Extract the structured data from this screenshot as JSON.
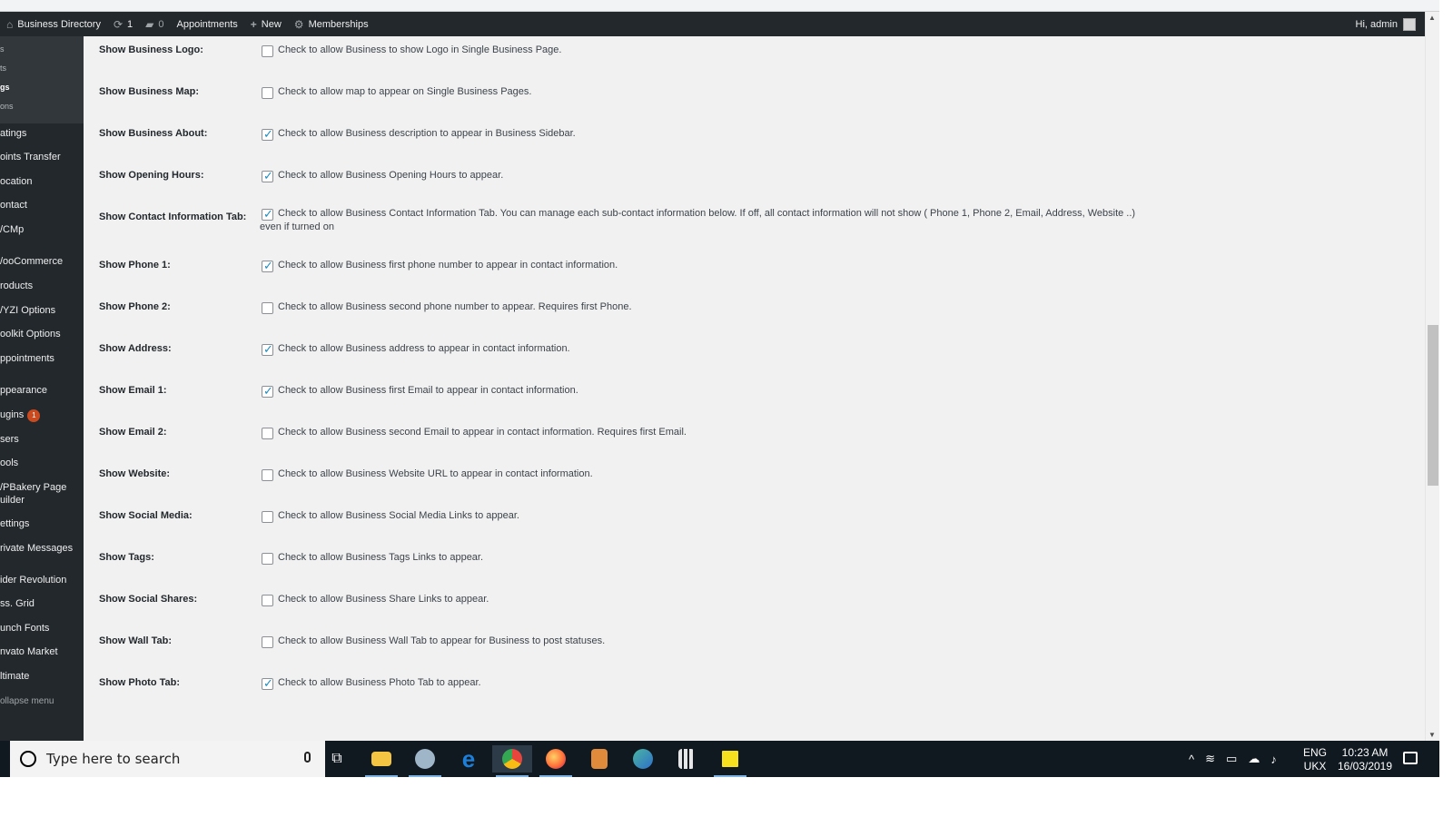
{
  "admin_bar": {
    "site_name": "Business Directory",
    "updates_count": "1",
    "comments_count": "0",
    "appointments": "Appointments",
    "new": "New",
    "memberships": "Memberships",
    "greeting": "Hi, admin"
  },
  "sidebar": {
    "sub_items": [
      {
        "label": "s"
      },
      {
        "label": "ts"
      },
      {
        "label": "gs"
      },
      {
        "label": "ons"
      }
    ],
    "items": [
      {
        "label": "atings",
        "badge": ""
      },
      {
        "label": "oints Transfer",
        "badge": ""
      },
      {
        "label": "ocation",
        "badge": ""
      },
      {
        "label": "ontact",
        "badge": ""
      },
      {
        "label": "/CMp",
        "badge": ""
      },
      {
        "label": "/ooCommerce",
        "badge": ""
      },
      {
        "label": "roducts",
        "badge": ""
      },
      {
        "label": "/YZI Options",
        "badge": ""
      },
      {
        "label": "oolkit Options",
        "badge": ""
      },
      {
        "label": "ppointments",
        "badge": ""
      },
      {
        "label": "ppearance",
        "badge": ""
      },
      {
        "label": "ugins",
        "badge": "1"
      },
      {
        "label": "sers",
        "badge": ""
      },
      {
        "label": "ools",
        "badge": ""
      },
      {
        "label": "/PBakery Page",
        "label2": "uilder",
        "badge": ""
      },
      {
        "label": "ettings",
        "badge": ""
      },
      {
        "label": "rivate Messages",
        "badge": ""
      },
      {
        "label": "ider Revolution",
        "badge": ""
      },
      {
        "label": "ss. Grid",
        "badge": ""
      },
      {
        "label": "unch Fonts",
        "badge": ""
      },
      {
        "label": "nvato Market",
        "badge": ""
      },
      {
        "label": "ltimate",
        "badge": ""
      },
      {
        "label": "ollapse menu",
        "badge": ""
      }
    ]
  },
  "settings": [
    {
      "label": "Show Business Logo:",
      "checked": false,
      "description": "Check to allow Business to show Logo in Single Business Page."
    },
    {
      "label": "Show Business Map:",
      "checked": false,
      "description": "Check to allow map to appear on Single Business Pages."
    },
    {
      "label": "Show Business About:",
      "checked": true,
      "description": "Check to allow Business description to appear in Business Sidebar."
    },
    {
      "label": "Show Opening Hours:",
      "checked": true,
      "description": "Check to allow Business Opening Hours to appear."
    },
    {
      "label": "Show Contact Information Tab:",
      "checked": true,
      "description": "Check to allow Business Contact Information Tab. You can manage each sub-contact information below. If off, all contact information will not show ( Phone 1, Phone 2, Email, Address, Website ..)",
      "description2": "even if turned on"
    },
    {
      "label": "Show Phone 1:",
      "checked": true,
      "description": "Check to allow Business first phone number to appear in contact information."
    },
    {
      "label": "Show Phone 2:",
      "checked": false,
      "description": "Check to allow Business second phone number to appear. Requires first Phone."
    },
    {
      "label": "Show Address:",
      "checked": true,
      "description": "Check to allow Business address to appear in contact information."
    },
    {
      "label": "Show Email 1:",
      "checked": true,
      "description": "Check to allow Business first Email to appear in contact information."
    },
    {
      "label": "Show Email 2:",
      "checked": false,
      "description": "Check to allow Business second Email to appear in contact information. Requires first Email."
    },
    {
      "label": "Show Website:",
      "checked": false,
      "description": "Check to allow Business Website URL to appear in contact information."
    },
    {
      "label": "Show Social Media:",
      "checked": false,
      "description": "Check to allow Business Social Media Links to appear."
    },
    {
      "label": "Show Tags:",
      "checked": false,
      "description": "Check to allow Business Tags Links to appear."
    },
    {
      "label": "Show Social Shares:",
      "checked": false,
      "description": "Check to allow Business Share Links to appear."
    },
    {
      "label": "Show Wall Tab:",
      "checked": false,
      "description": "Check to allow Business Wall Tab to appear for Business to post statuses."
    },
    {
      "label": "Show Photo Tab:",
      "checked": true,
      "description": "Check to allow Business Photo Tab to appear."
    }
  ],
  "taskbar": {
    "search_placeholder": "Type here to search",
    "apps": [
      {
        "icon": "task-view-icon",
        "color": "#ffffff"
      },
      {
        "icon": "file-explorer-icon",
        "color": "#f4c542"
      },
      {
        "icon": "paint-icon",
        "color": "#9fb6c9"
      },
      {
        "icon": "edge-icon",
        "color": "#1e7fd8"
      },
      {
        "icon": "chrome-icon",
        "color": "#e8453c"
      },
      {
        "icon": "firefox-icon",
        "color": "#ff7139"
      },
      {
        "icon": "html-editor-icon",
        "color": "#e08a3c"
      },
      {
        "icon": "maps-icon",
        "color": "#49b6a1"
      },
      {
        "icon": "calculator-icon",
        "color": "#e6e6e6"
      },
      {
        "icon": "sticky-notes-icon",
        "color": "#f7e11e"
      }
    ],
    "language": "ENG",
    "keyboard": "UKX",
    "time": "10:23 AM",
    "date": "16/03/2019"
  }
}
